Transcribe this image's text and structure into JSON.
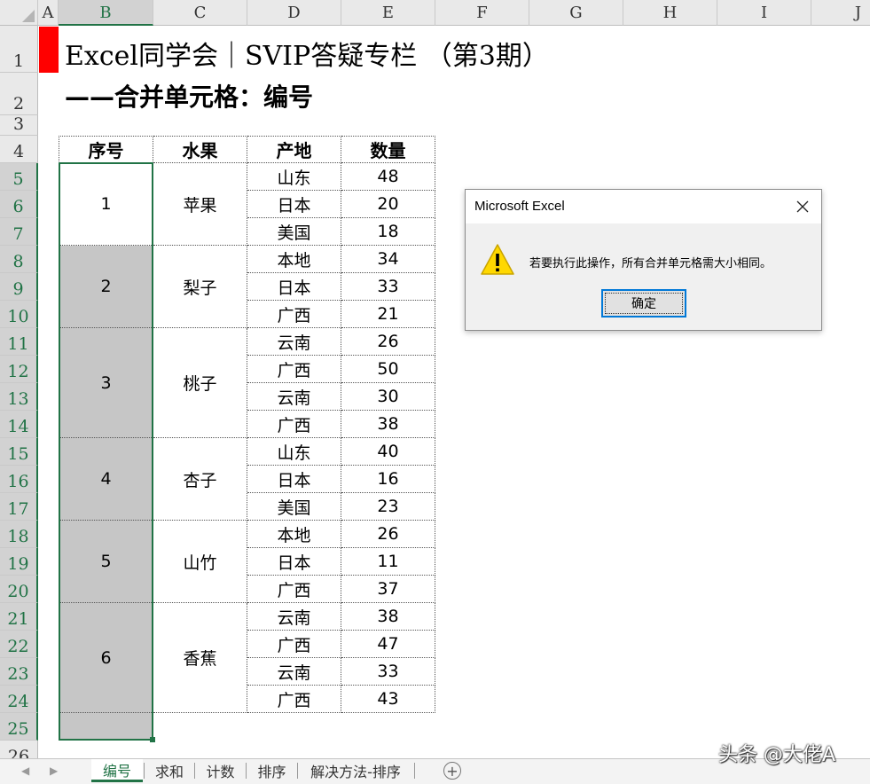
{
  "columns": [
    "A",
    "B",
    "C",
    "D",
    "E",
    "F",
    "G",
    "H",
    "I",
    "J"
  ],
  "rows": [
    "1",
    "2",
    "3",
    "4",
    "5",
    "6",
    "7",
    "8",
    "9",
    "10",
    "11",
    "12",
    "13",
    "14",
    "15",
    "16",
    "17",
    "18",
    "19",
    "20",
    "21",
    "22",
    "23",
    "24",
    "25",
    "26"
  ],
  "title_line1": "Excel同学会｜SVIP答疑专栏 （第3期）",
  "title_line2": "——合并单元格：编号",
  "table": {
    "headers": [
      "序号",
      "水果",
      "产地",
      "数量"
    ],
    "groups": [
      {
        "id": "1",
        "fruit": "苹果",
        "items": [
          {
            "origin": "山东",
            "qty": "48"
          },
          {
            "origin": "日本",
            "qty": "20"
          },
          {
            "origin": "美国",
            "qty": "18"
          }
        ]
      },
      {
        "id": "2",
        "fruit": "梨子",
        "items": [
          {
            "origin": "本地",
            "qty": "34"
          },
          {
            "origin": "日本",
            "qty": "33"
          },
          {
            "origin": "广西",
            "qty": "21"
          }
        ]
      },
      {
        "id": "3",
        "fruit": "桃子",
        "items": [
          {
            "origin": "云南",
            "qty": "26"
          },
          {
            "origin": "广西",
            "qty": "50"
          },
          {
            "origin": "云南",
            "qty": "30"
          },
          {
            "origin": "广西",
            "qty": "38"
          }
        ]
      },
      {
        "id": "4",
        "fruit": "杏子",
        "items": [
          {
            "origin": "山东",
            "qty": "40"
          },
          {
            "origin": "日本",
            "qty": "16"
          },
          {
            "origin": "美国",
            "qty": "23"
          }
        ]
      },
      {
        "id": "5",
        "fruit": "山竹",
        "items": [
          {
            "origin": "本地",
            "qty": "26"
          },
          {
            "origin": "日本",
            "qty": "11"
          },
          {
            "origin": "广西",
            "qty": "37"
          }
        ]
      },
      {
        "id": "6",
        "fruit": "香蕉",
        "items": [
          {
            "origin": "云南",
            "qty": "38"
          },
          {
            "origin": "广西",
            "qty": "47"
          },
          {
            "origin": "云南",
            "qty": "33"
          },
          {
            "origin": "广西",
            "qty": "43"
          }
        ]
      }
    ]
  },
  "dialog": {
    "title": "Microsoft Excel",
    "message": "若要执行此操作，所有合并单元格需大小相同。",
    "ok_label": "确定"
  },
  "sheet_tabs": [
    "编号",
    "求和",
    "计数",
    "排序",
    "解决方法-排序"
  ],
  "active_tab": "编号",
  "watermark": "头条 @大佬A",
  "colors": {
    "accent": "#217346",
    "red_marker": "#ff0000",
    "selected_fill": "#c6c6c6",
    "dialog_ok_border": "#0078d7"
  }
}
